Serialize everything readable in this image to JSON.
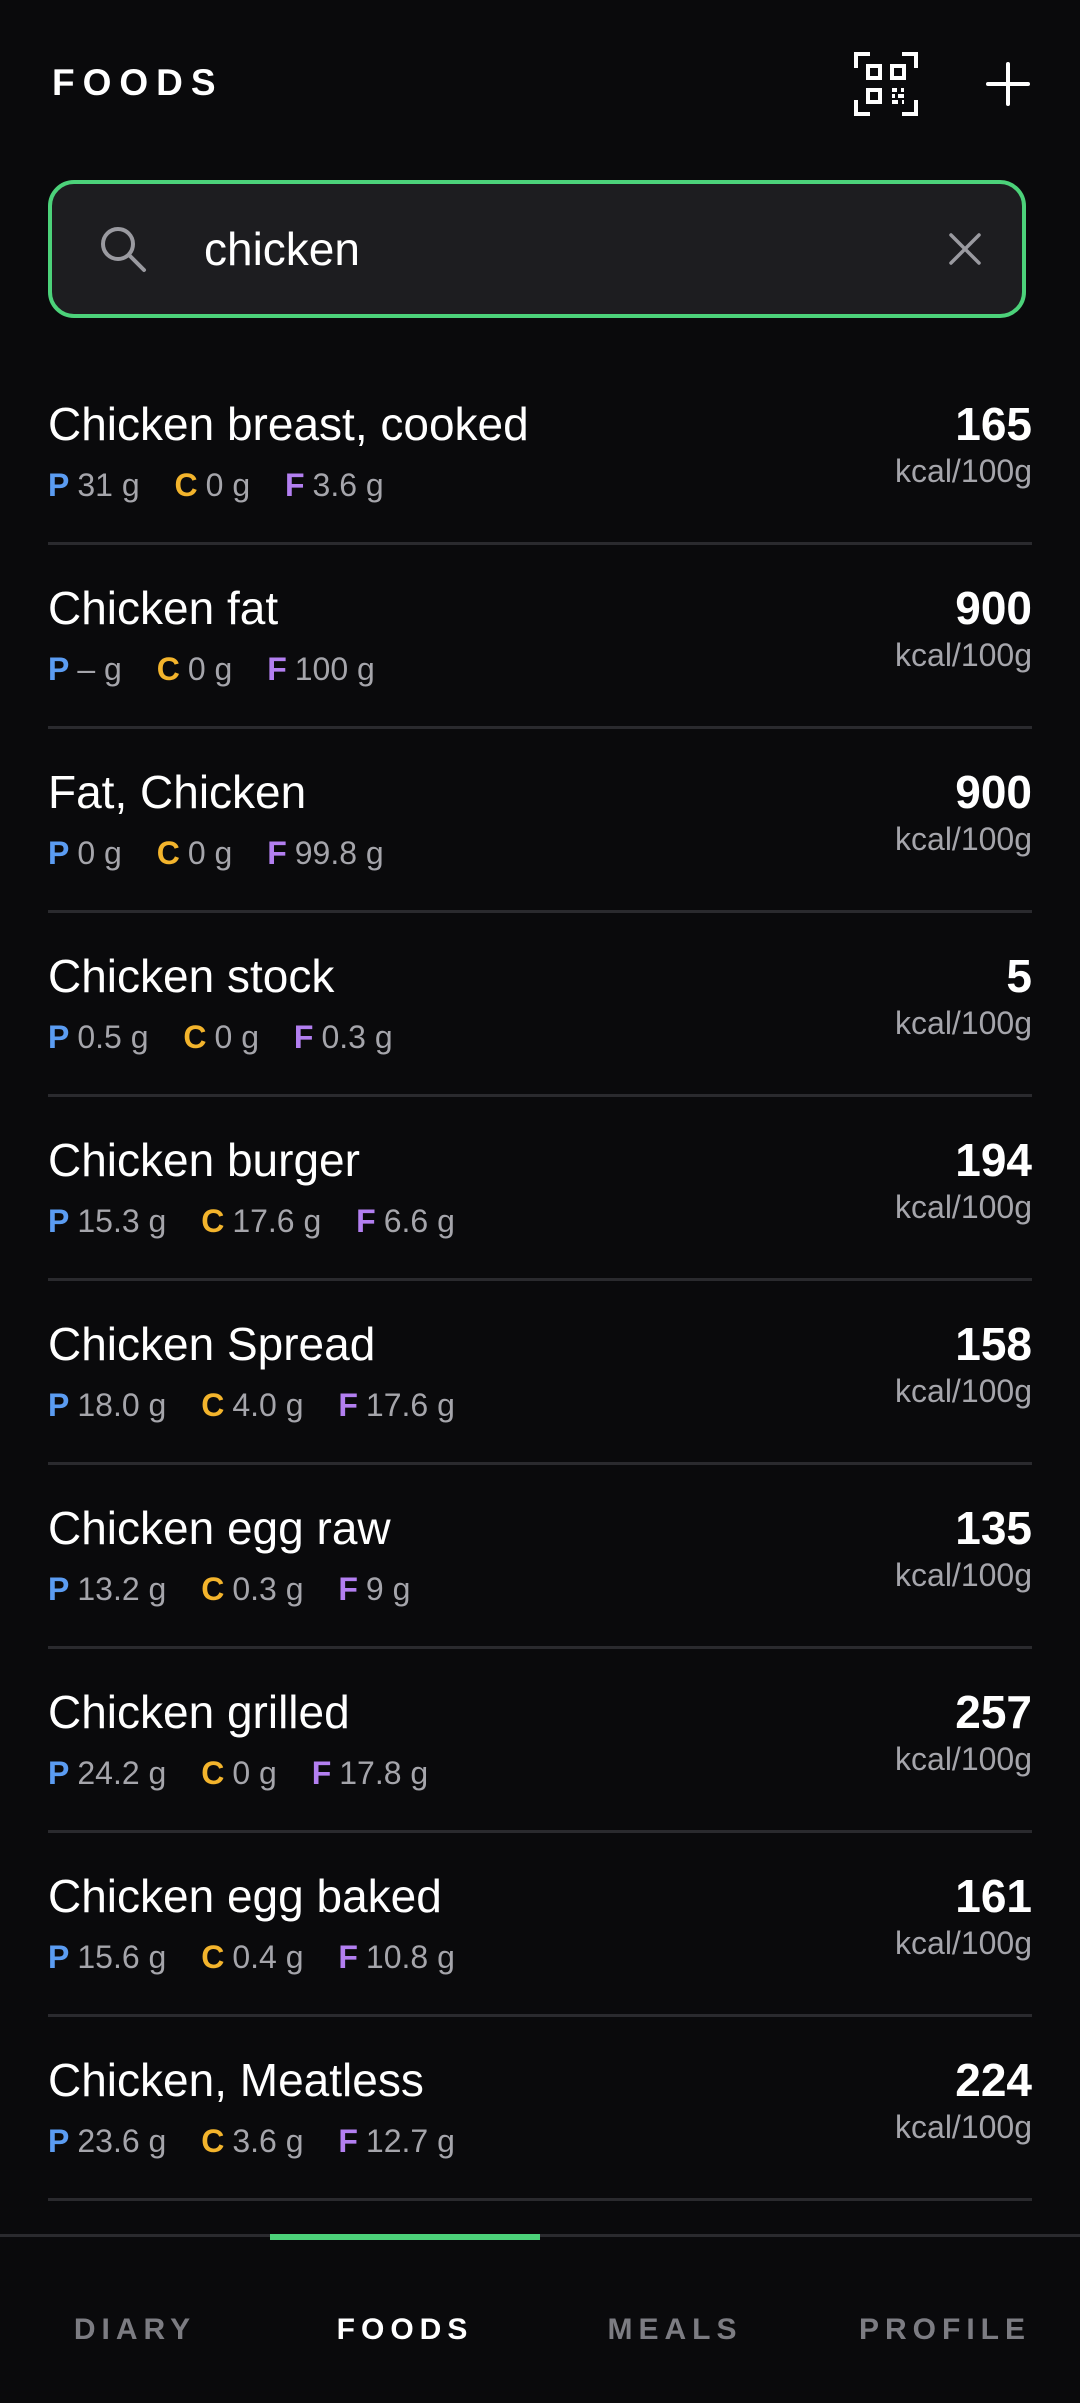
{
  "header": {
    "title": "FOODS",
    "qr_icon": "qr-scan-icon",
    "add_icon": "plus-icon"
  },
  "search": {
    "value": "chicken",
    "search_icon": "search-icon",
    "clear_icon": "close-icon",
    "accent_color": "#4cd27a"
  },
  "macro_colors": {
    "protein": "#5b9cf2",
    "carbs": "#f3b42c",
    "fat": "#b37ff1"
  },
  "macro_letters": {
    "protein": "P",
    "carbs": "C",
    "fat": "F"
  },
  "foods": [
    {
      "name": "Chicken breast, cooked",
      "protein": "31 g",
      "carbs": "0 g",
      "fat": "3.6 g",
      "kcal": "165",
      "unit": "kcal/100g"
    },
    {
      "name": "Chicken fat",
      "protein": "– g",
      "carbs": "0 g",
      "fat": "100 g",
      "kcal": "900",
      "unit": "kcal/100g"
    },
    {
      "name": "Fat, Chicken",
      "protein": "0 g",
      "carbs": "0 g",
      "fat": "99.8 g",
      "kcal": "900",
      "unit": "kcal/100g"
    },
    {
      "name": "Chicken stock",
      "protein": "0.5 g",
      "carbs": "0 g",
      "fat": "0.3 g",
      "kcal": "5",
      "unit": "kcal/100g"
    },
    {
      "name": "Chicken burger",
      "protein": "15.3 g",
      "carbs": "17.6 g",
      "fat": "6.6 g",
      "kcal": "194",
      "unit": "kcal/100g"
    },
    {
      "name": "Chicken Spread",
      "protein": "18.0 g",
      "carbs": "4.0 g",
      "fat": "17.6 g",
      "kcal": "158",
      "unit": "kcal/100g"
    },
    {
      "name": "Chicken egg raw",
      "protein": "13.2 g",
      "carbs": "0.3 g",
      "fat": "9 g",
      "kcal": "135",
      "unit": "kcal/100g"
    },
    {
      "name": "Chicken grilled",
      "protein": "24.2 g",
      "carbs": "0 g",
      "fat": "17.8 g",
      "kcal": "257",
      "unit": "kcal/100g"
    },
    {
      "name": "Chicken egg baked",
      "protein": "15.6 g",
      "carbs": "0.4 g",
      "fat": "10.8 g",
      "kcal": "161",
      "unit": "kcal/100g"
    },
    {
      "name": "Chicken, Meatless",
      "protein": "23.6 g",
      "carbs": "3.6 g",
      "fat": "12.7 g",
      "kcal": "224",
      "unit": "kcal/100g"
    }
  ],
  "nav": {
    "tabs": [
      {
        "label": "DIARY",
        "active": false
      },
      {
        "label": "FOODS",
        "active": true
      },
      {
        "label": "MEALS",
        "active": false
      },
      {
        "label": "PROFILE",
        "active": false
      }
    ]
  }
}
